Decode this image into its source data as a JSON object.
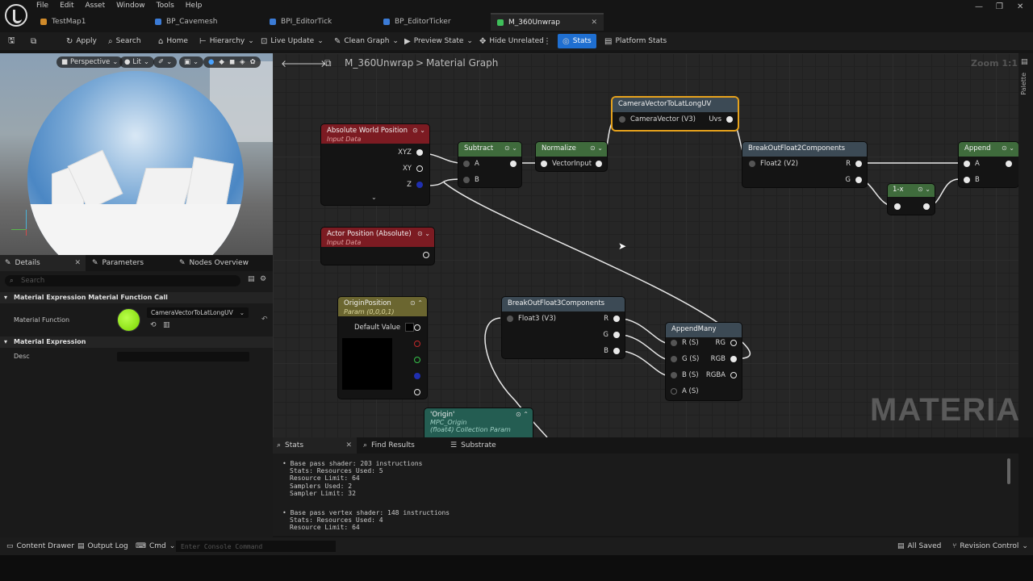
{
  "menu": [
    "File",
    "Edit",
    "Asset",
    "Window",
    "Tools",
    "Help"
  ],
  "tabs": [
    {
      "label": "TestMap1",
      "color": "#d08a2a"
    },
    {
      "label": "BP_Cavemesh",
      "color": "#3b7bd6"
    },
    {
      "label": "BPI_EditorTick",
      "color": "#3b7bd6"
    },
    {
      "label": "BP_EditorTicker",
      "color": "#3b7bd6"
    },
    {
      "label": "M_360Unwrap",
      "color": "#3fbf5a"
    }
  ],
  "toolbar": {
    "apply": "Apply",
    "search": "Search",
    "home": "Home",
    "hierarchy": "Hierarchy",
    "live_update": "Live Update",
    "clean_graph": "Clean Graph",
    "preview_state": "Preview State",
    "hide_unrelated": "Hide Unrelated",
    "stats": "Stats",
    "platform_stats": "Platform Stats"
  },
  "viewport": {
    "perspective": "Perspective",
    "lit": "Lit"
  },
  "details": {
    "tabs": [
      "Details",
      "Parameters",
      "Nodes Overview"
    ],
    "search_placeholder": "Search",
    "section1": "Material Expression Material Function Call",
    "material_function_label": "Material Function",
    "material_function_value": "CameraVectorToLatLongUV",
    "section2": "Material Expression",
    "desc_label": "Desc"
  },
  "graph": {
    "breadcrumb_asset": "M_360Unwrap",
    "breadcrumb_sep": ">",
    "breadcrumb_graph": "Material Graph",
    "zoom": "Zoom 1:1",
    "watermark": "MATERIAL",
    "palette": "Palette",
    "nodes": {
      "awp": {
        "title": "Absolute World Position",
        "sub": "Input Data",
        "pins": [
          "XYZ",
          "XY",
          "Z"
        ]
      },
      "actor": {
        "title": "Actor Position (Absolute)",
        "sub": "Input Data"
      },
      "subtract": {
        "title": "Subtract",
        "pins": [
          "A",
          "B"
        ]
      },
      "normalize": {
        "title": "Normalize",
        "pin": "VectorInput"
      },
      "cam": {
        "title": "CameraVectorToLatLongUV",
        "in": "CameraVector (V3)",
        "out": "Uvs"
      },
      "break2": {
        "title": "BreakOutFloat2Components",
        "in": "Float2 (V2)",
        "out": [
          "R",
          "G"
        ]
      },
      "append": {
        "title": "Append",
        "pins": [
          "A",
          "B"
        ]
      },
      "oneminus": {
        "title": "1-x"
      },
      "origin": {
        "title": "OriginPosition",
        "sub": "Param (0,0,0,1)",
        "default": "Default Value"
      },
      "break3": {
        "title": "BreakOutFloat3Components",
        "in": "Float3 (V3)",
        "out": [
          "R",
          "G",
          "B"
        ]
      },
      "appendmany": {
        "title": "AppendMany",
        "in": [
          "R (S)",
          "G (S)",
          "B (S)",
          "A (S)"
        ],
        "out": [
          "RG",
          "RGB",
          "RGBA"
        ]
      },
      "mpc": {
        "title": "'Origin'",
        "sub1": "MPC_Origin",
        "sub2": "(float4) Collection Param"
      }
    }
  },
  "stats": {
    "tabs": [
      "Stats",
      "Find Results",
      "Substrate"
    ],
    "block1": [
      "Base pass shader: 203 instructions",
      "Stats: Resources Used: 5",
      "Resource Limit: 64",
      "Samplers Used: 2",
      "Sampler Limit: 32"
    ],
    "block2": [
      "Base pass vertex shader: 148 instructions",
      "Stats: Resources Used: 4",
      "Resource Limit: 64"
    ]
  },
  "statusbar": {
    "content_drawer": "Content Drawer",
    "output_log": "Output Log",
    "cmd": "Cmd",
    "console_placeholder": "Enter Console Command",
    "all_saved": "All Saved",
    "revision_control": "Revision Control"
  }
}
